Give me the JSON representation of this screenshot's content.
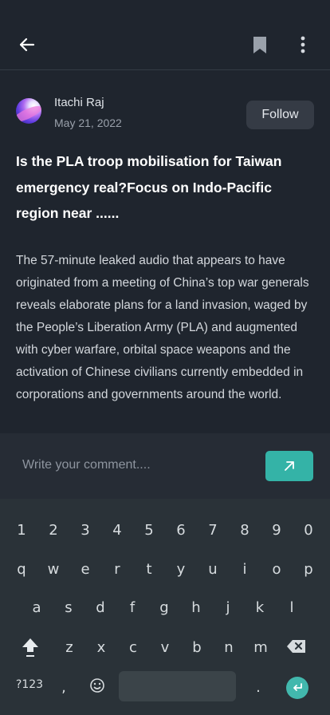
{
  "colors": {
    "background": "#1f252e",
    "accent": "#34b3a7",
    "keyboard": "#2a3238"
  },
  "topbar": {
    "back_icon": "arrow-left-icon",
    "bookmark_icon": "bookmark-icon",
    "more_icon": "more-vertical-icon"
  },
  "author": {
    "name": "Itachi Raj",
    "date": "May 21, 2022",
    "follow_label": "Follow"
  },
  "article": {
    "headline": "Is the PLA troop mobilisation for Taiwan emergency real?Focus on Indo-Pacific region near ......",
    "body": "The 57-minute leaked audio that appears to have originated from a meeting of China’s top war generals reveals elaborate plans for a land invasion, waged by the People’s Liberation Army (PLA) and augmented with cyber warfare, orbital space weapons and the activation of Chinese civilians currently embedded in corporations and governments around the world."
  },
  "comment": {
    "placeholder": "Write your comment....",
    "send_icon": "arrow-up-right-icon"
  },
  "keyboard": {
    "row_numbers": [
      "1",
      "2",
      "3",
      "4",
      "5",
      "6",
      "7",
      "8",
      "9",
      "0"
    ],
    "row_1": [
      "q",
      "w",
      "e",
      "r",
      "t",
      "y",
      "u",
      "i",
      "o",
      "p"
    ],
    "row_2": [
      "a",
      "s",
      "d",
      "f",
      "g",
      "h",
      "j",
      "k",
      "l"
    ],
    "row_3": [
      "z",
      "x",
      "c",
      "v",
      "b",
      "n",
      "m"
    ],
    "symbols_label": "?123",
    "comma": ",",
    "period": ".",
    "shift_icon": "shift-icon",
    "backspace_icon": "backspace-icon",
    "emoji_icon": "emoji-icon",
    "enter_icon": "enter-icon"
  }
}
